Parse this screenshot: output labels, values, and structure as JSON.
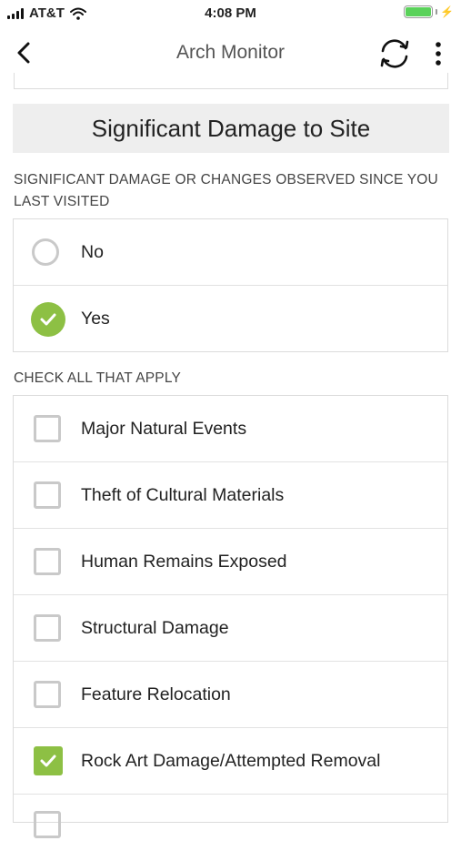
{
  "status_bar": {
    "carrier": "AT&T",
    "time": "4:08 PM",
    "signal_icon": "signal-bars-icon",
    "wifi_icon": "wifi-icon",
    "battery_icon": "battery-icon",
    "charging_icon": "charging-bolt-icon",
    "battery_level": 1.0
  },
  "nav": {
    "title": "Arch Monitor",
    "back_icon": "back-chevron-icon",
    "sync_icon": "sync-icon",
    "more_icon": "more-vertical-icon"
  },
  "section": {
    "title": "Significant Damage to Site"
  },
  "damage_question": {
    "label": "SIGNIFICANT DAMAGE OR CHANGES OBSERVED SINCE YOU LAST VISITED",
    "options": [
      {
        "label": "No",
        "selected": false
      },
      {
        "label": "Yes",
        "selected": true
      }
    ]
  },
  "check_all": {
    "label": "CHECK ALL THAT APPLY",
    "options": [
      {
        "label": "Major Natural Events",
        "checked": false
      },
      {
        "label": "Theft of Cultural Materials",
        "checked": false
      },
      {
        "label": "Human Remains Exposed",
        "checked": false
      },
      {
        "label": "Structural Damage",
        "checked": false
      },
      {
        "label": "Feature Relocation",
        "checked": false
      },
      {
        "label": "Rock Art Damage/Attempted Removal",
        "checked": true
      }
    ]
  },
  "colors": {
    "accent_green": "#8dc044",
    "unchecked_gray": "#c9c9c9",
    "header_bg": "#eeeeee",
    "battery_green": "#5ad25a"
  }
}
